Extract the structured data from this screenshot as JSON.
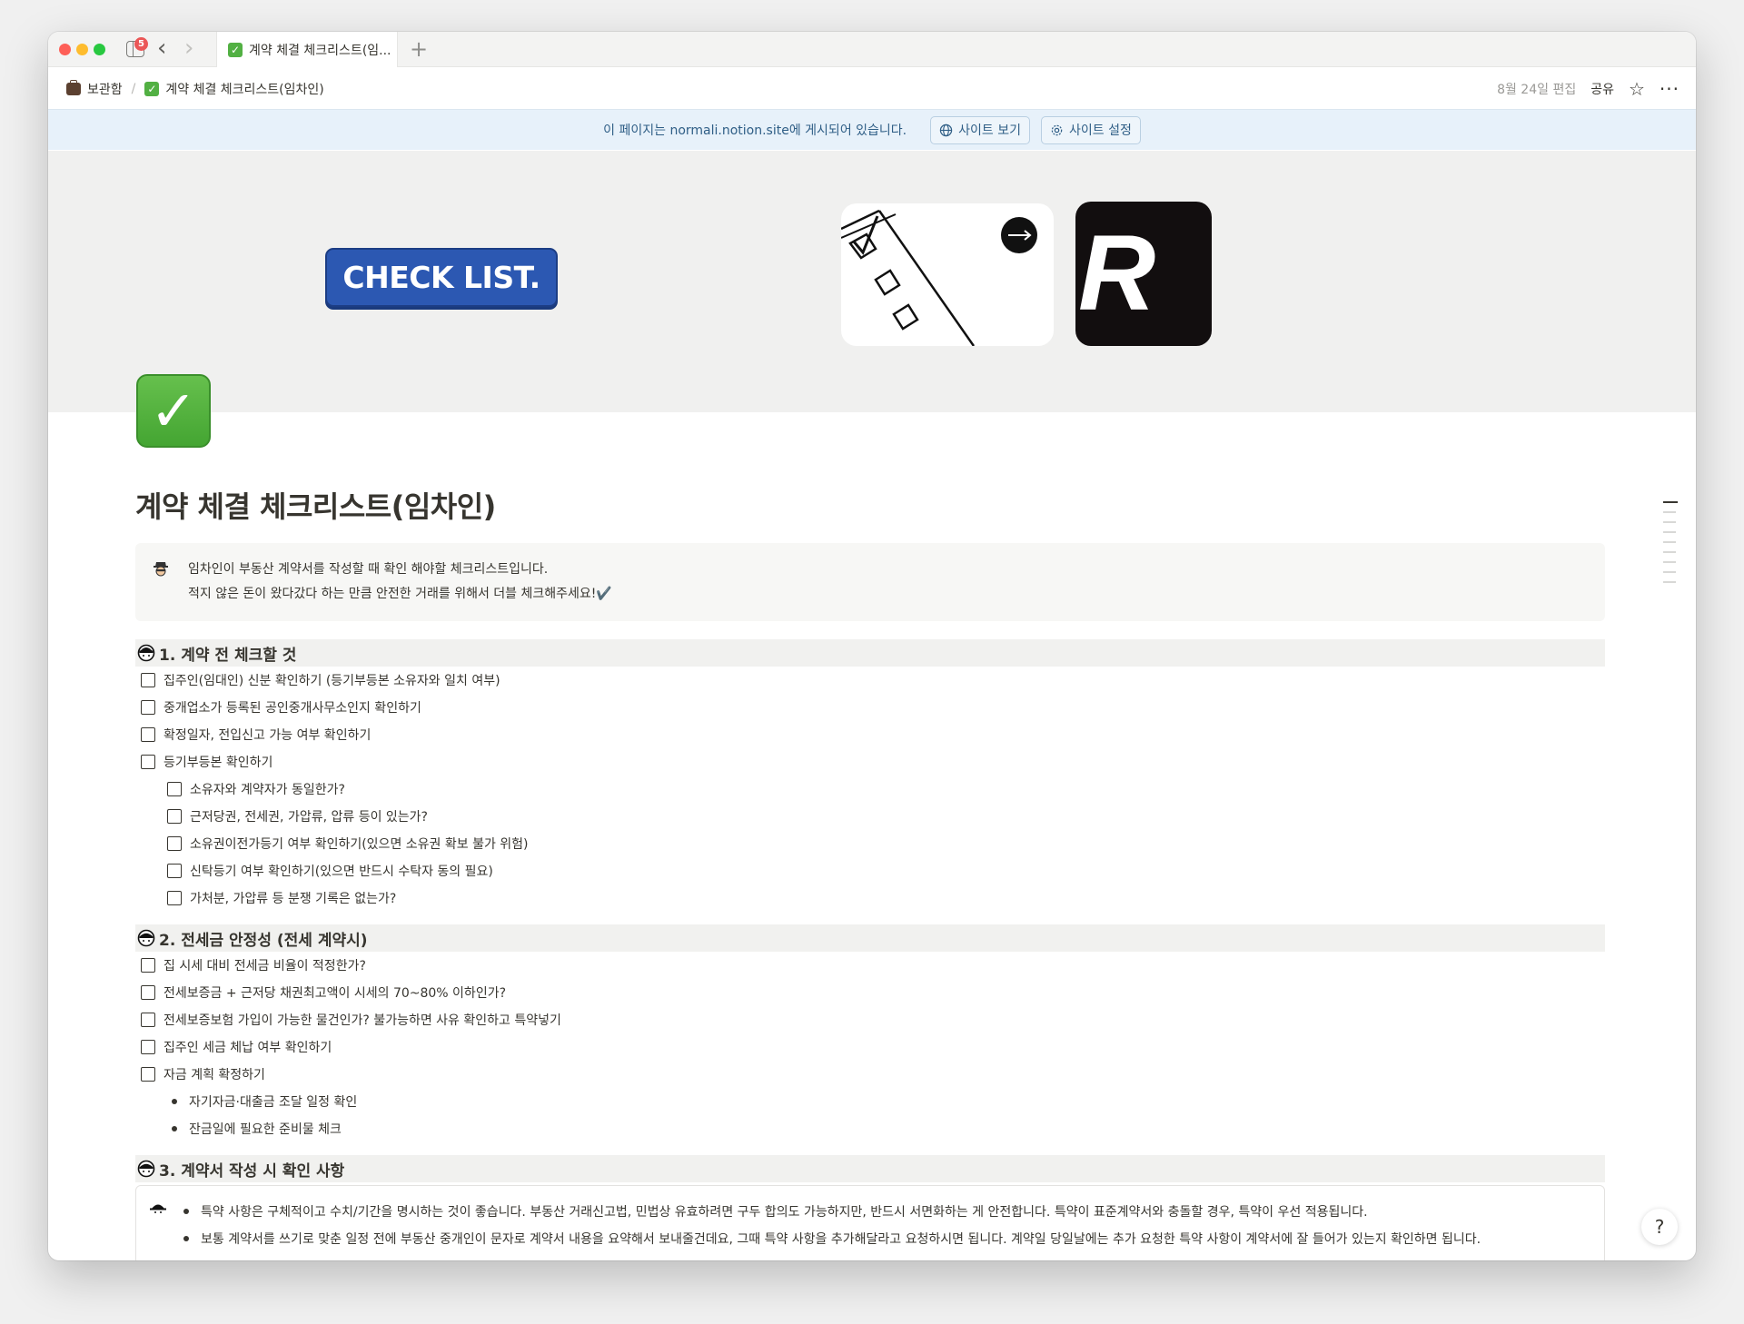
{
  "tab": {
    "title": "계약 체결 체크리스트(임...",
    "notification_count": "5"
  },
  "breadcrumb": {
    "root": "보관함",
    "page": "계약 체결 체크리스트(임차인)"
  },
  "topbar": {
    "edited": "8월 24일 편집",
    "share": "공유"
  },
  "banner": {
    "text": "이 페이지는 normali.notion.site에 게시되어 있습니다.",
    "view_site": "사이트 보기",
    "site_settings": "사이트 설정"
  },
  "cover": {
    "checklist_label": "CHECK LIST.",
    "r_letter": "R"
  },
  "page": {
    "title": "계약 체결 체크리스트(임차인)",
    "callout_lines": [
      "임차인이 부동산 계약서를 작성할 때 확인 해야할 체크리스트입니다.",
      "적지 않은 돈이 왔다갔다 하는 만큼 안전한 거래를 위해서 더블 체크해주세요!✔️"
    ]
  },
  "sections": [
    {
      "heading": "1. 계약 전 체크할 것",
      "items": [
        "집주인(임대인) 신분 확인하기 (등기부등본 소유자와 일치 여부)",
        "중개업소가 등록된 공인중개사무소인지 확인하기",
        "확정일자, 전입신고 가능 여부 확인하기",
        "등기부등본 확인하기"
      ],
      "sub_items": [
        "소유자와 계약자가 동일한가?",
        "근저당권, 전세권, 가압류, 압류 등이 있는가?",
        "소유권이전가등기 여부 확인하기(있으면 소유권 확보 불가 위험)",
        "신탁등기 여부 확인하기(있으면 반드시 수탁자 동의 필요)",
        "가처분, 가압류 등 분쟁 기록은 없는가?"
      ]
    },
    {
      "heading": "2. 전세금 안정성 (전세 계약시)",
      "items": [
        "집 시세 대비 전세금 비율이 적정한가?",
        "전세보증금 + 근저당 채권최고액이 시세의 70~80% 이하인가?",
        "전세보증보험 가입이 가능한 물건인가? 불가능하면 사유 확인하고 특약넣기",
        "집주인 세금 체납 여부 확인하기",
        "자금 계획 확정하기"
      ],
      "bullets": [
        "자기자금·대출금 조달 일정 확인",
        "잔금일에 필요한 준비물 체크"
      ]
    },
    {
      "heading": "3. 계약서 작성 시 확인 사항",
      "callout_bullets": [
        "특약 사항은 구체적이고 수치/기간을 명시하는 것이 좋습니다. 부동산 거래신고법, 민법상 유효하려면 구두 합의도 가능하지만, 반드시 서면화하는 게 안전합니다. 특약이 표준계약서와 충돌할 경우, 특약이 우선 적용됩니다.",
        "보통 계약서를 쓰기로 맞춘 일정 전에 부동산 중개인이 문자로 계약서 내용을 요약해서 보내줄건데요, 그때 특약 사항을 추가해달라고 요청하시면 됩니다. 계약일 당일날에는 추가 요청한 특약 사항이 계약서에 잘 들어가 있는지 확인하면 됩니다."
      ]
    }
  ],
  "colors": {
    "accent_blue": "#2c58b2",
    "banner_bg": "#e7f1fa",
    "check_green": "#52b043"
  }
}
